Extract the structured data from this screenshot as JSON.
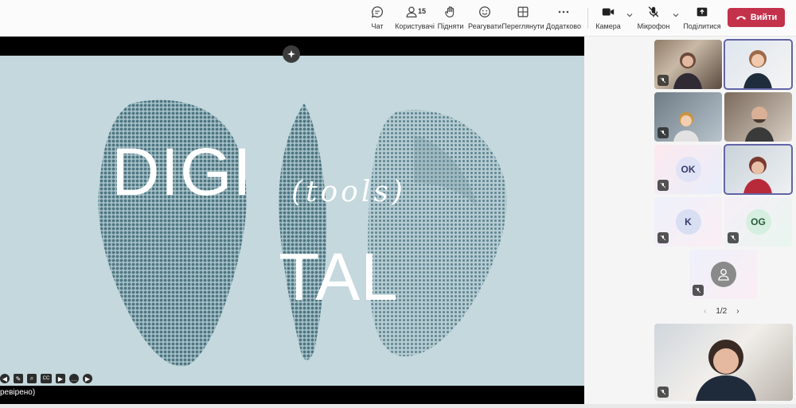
{
  "toolbar": {
    "chat_label": "Чат",
    "people_label": "Користувачі",
    "people_count": "15",
    "raise_label": "Підняти",
    "react_label": "Реагувати",
    "view_label": "Переглянути",
    "more_label": "Додатково",
    "camera_label": "Камера",
    "mic_label": "Мікрофон",
    "share_label": "Поділитися",
    "leave_label": "Вийти"
  },
  "slide": {
    "word1": "DIGI",
    "word2": "TAL",
    "word3": "(tools)"
  },
  "caption": "ревірено)",
  "participants": {
    "initials_ok": "OK",
    "initials_k": "K",
    "initials_og": "OG",
    "pager": "1/2"
  },
  "colors": {
    "slide_bg": "#c4d8dd",
    "leave": "#c4314b",
    "accent": "#6264a7"
  }
}
